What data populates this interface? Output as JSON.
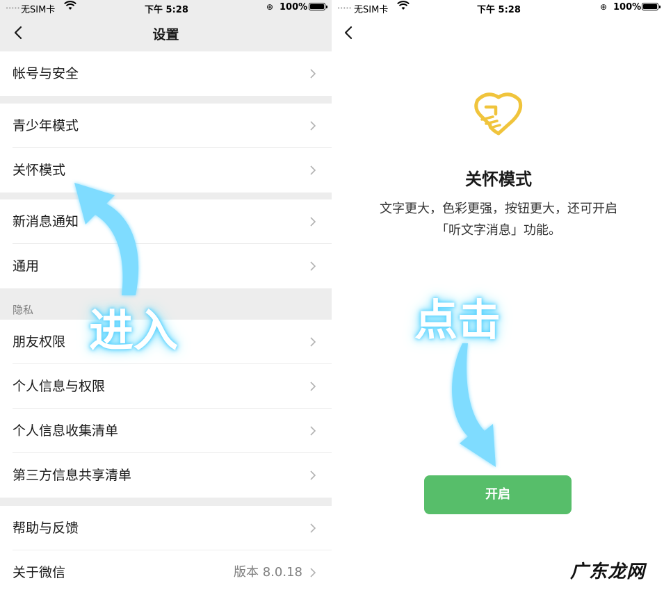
{
  "status_bar": {
    "signal": "•••••",
    "carrier": "无SIM卡",
    "time": "下午 5:28",
    "lock_icon": "orientation-lock-icon",
    "battery": "100%"
  },
  "settings": {
    "title": "设置",
    "groups": [
      {
        "items": [
          {
            "label": "帐号与安全"
          }
        ]
      },
      {
        "items": [
          {
            "label": "青少年模式"
          },
          {
            "label": "关怀模式"
          }
        ]
      },
      {
        "items": [
          {
            "label": "新消息通知"
          },
          {
            "label": "通用"
          }
        ]
      },
      {
        "section_label": "隐私",
        "items": [
          {
            "label": "朋友权限"
          },
          {
            "label": "个人信息与权限"
          },
          {
            "label": "个人信息收集清单"
          },
          {
            "label": "第三方信息共享清单"
          }
        ]
      },
      {
        "items": [
          {
            "label": "帮助与反馈"
          },
          {
            "label": "关于微信",
            "value": "版本 8.0.18"
          }
        ]
      }
    ]
  },
  "care_mode": {
    "icon": "care-heart-hand-icon",
    "icon_color": "#f0c43c",
    "title": "关怀模式",
    "desc_line1": "文字更大，色彩更强，按钮更大，还可开启",
    "desc_line2": "「听文字消息」功能。",
    "button_label": "开启",
    "button_color": "#57be6a"
  },
  "annotations": {
    "enter_text": "进入",
    "click_text": "点击",
    "arrow_color": "#7fdcff"
  },
  "watermark": "广东龙网"
}
